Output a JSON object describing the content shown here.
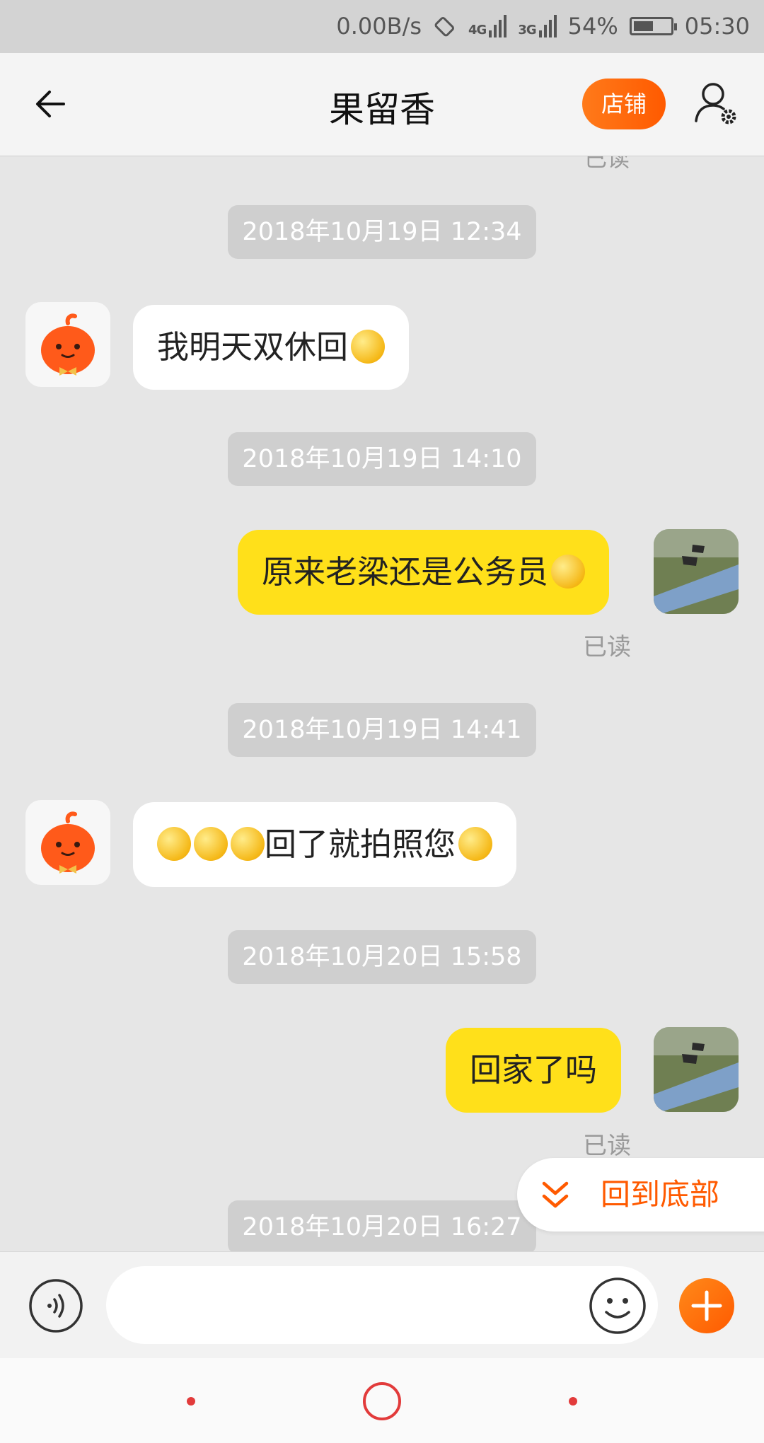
{
  "status_bar": {
    "speed": "0.00B/s",
    "net1": "4G",
    "net2": "3G",
    "battery": "54%",
    "battery_level": 0.54,
    "time": "05:30"
  },
  "header": {
    "title": "果留香",
    "store_label": "店铺"
  },
  "chat": {
    "cut_read_label": "已读",
    "timestamps": [
      "2018年10月19日 12:34",
      "2018年10月19日 14:10",
      "2018年10月19日 14:41",
      "2018年10月20日 15:58",
      "2018年10月20日 16:27"
    ],
    "messages": [
      {
        "from": "shop",
        "text": "我明天双休回",
        "emojis": [
          "smile-emoji"
        ]
      },
      {
        "from": "me",
        "text": "原来老梁还是公务员",
        "emojis": [
          "surprised-emoji"
        ],
        "status": "已读"
      },
      {
        "from": "shop",
        "text_before": "",
        "text": "回了就拍照您",
        "emojis_before": [
          "blush-emoji",
          "blush-emoji",
          "blush-emoji"
        ],
        "emojis": [
          "tongue-emoji"
        ]
      },
      {
        "from": "me",
        "text": "回家了吗",
        "status": "已读"
      }
    ]
  },
  "back_to_bottom": {
    "label": "回到底部"
  },
  "input": {
    "placeholder": ""
  },
  "colors": {
    "accent": "#ff5a00",
    "out_bubble": "#ffe01a",
    "in_bubble": "#ffffff",
    "background": "#e6e6e6"
  }
}
